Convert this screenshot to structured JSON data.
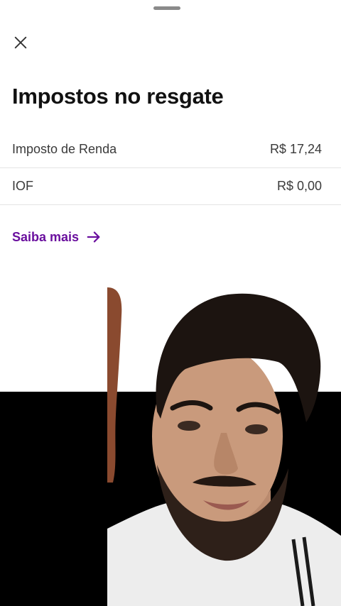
{
  "sheet": {
    "title": "Impostos no resgate",
    "close_icon": "close-icon",
    "rows": [
      {
        "label": "Imposto de Renda",
        "value": "R$ 17,24"
      },
      {
        "label": "IOF",
        "value": "R$ 0,00"
      }
    ],
    "link_label": "Saiba mais",
    "link_icon": "arrow-right-icon",
    "accent_color": "#6a0f9e"
  }
}
